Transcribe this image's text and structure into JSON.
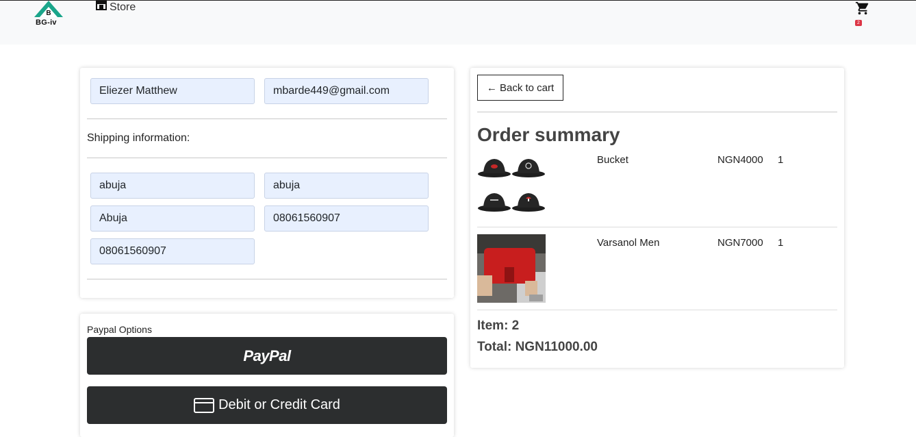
{
  "navbar": {
    "brand_text": "BG-iv",
    "store_label": "Store",
    "cart_count": "2"
  },
  "customer": {
    "name_value": "Eliezer Matthew",
    "email_value": "mbarde449@gmail.com"
  },
  "shipping": {
    "label": "Shipping information:",
    "address_value": "abuja",
    "city_value": "abuja",
    "state_value": "Abuja",
    "zip_value": "08061560907",
    "phone_value": "08061560907"
  },
  "payment": {
    "label": "Paypal Options",
    "paypal_button": "PayPal",
    "card_button": "Debit or Credit Card"
  },
  "summary": {
    "back_label": "← Back to cart",
    "title": "Order summary",
    "items": [
      {
        "name": "Bucket",
        "price": "NGN4000",
        "qty": "1",
        "image": "bucket-hats-image"
      },
      {
        "name": "Varsanol Men",
        "price": "NGN7000",
        "qty": "1",
        "image": "red-shorts-image"
      }
    ],
    "item_count": "Item: 2",
    "total": "Total: NGN11000.00"
  },
  "colors": {
    "navbar_bg": "#f8f9fa",
    "field_bg": "#e8f0fe",
    "paypal_button_bg": "#2c2e2f",
    "badge": "#dc3545"
  }
}
